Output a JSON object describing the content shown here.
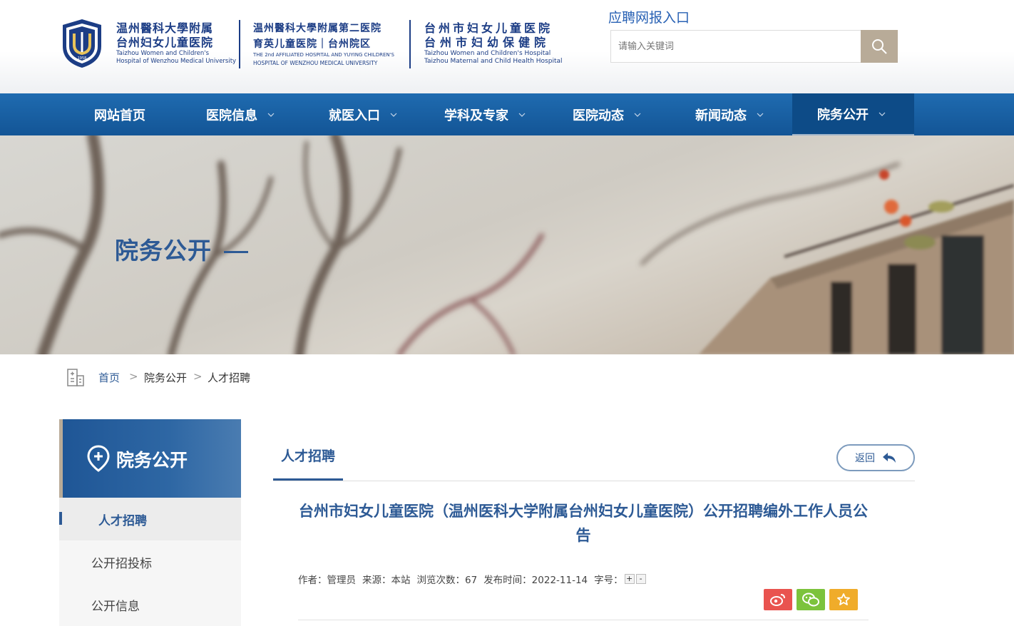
{
  "header": {
    "logo1": {
      "cn_line1": "温州醫科大學附属",
      "cn_line2": "台州妇女儿童医院",
      "en_line1": "Taizhou Women and Children's",
      "en_line2": "Hospital of Wenzhou Medical University",
      "emblem_year": "1958"
    },
    "logo2": {
      "cn_line1": "温州醫科大學附属第二医院",
      "cn_line2": "育英儿童医院｜台州院区",
      "en_line1": "THE 2nd AFFILIATED HOSPITAL AND YUYING CHILDREN'S",
      "en_line2": "HOSPITAL OF WENZHOU MEDICAL UNIVERSITY"
    },
    "logo3": {
      "cn_line1": "台州市妇女儿童医院",
      "cn_line2": "台州市妇幼保健院",
      "en_line1": "Taizhou Women and Children's Hospital",
      "en_line2": "Taizhou Maternal and Child Health Hospital"
    },
    "recruit_link": "应聘网报入口",
    "search": {
      "placeholder": "请输入关键词",
      "icon": "search-icon"
    }
  },
  "nav": {
    "items": [
      {
        "label": "网站首页",
        "dropdown": false,
        "active": false
      },
      {
        "label": "医院信息",
        "dropdown": true,
        "active": false
      },
      {
        "label": "就医入口",
        "dropdown": true,
        "active": false
      },
      {
        "label": "学科及专家",
        "dropdown": true,
        "active": false
      },
      {
        "label": "医院动态",
        "dropdown": true,
        "active": false
      },
      {
        "label": "新闻动态",
        "dropdown": true,
        "active": false
      },
      {
        "label": "院务公开",
        "dropdown": true,
        "active": true
      }
    ]
  },
  "banner": {
    "title": "院务公开"
  },
  "breadcrumb": {
    "home": "首页",
    "level1": "院务公开",
    "current": "人才招聘",
    "separator": ">"
  },
  "sidebar": {
    "title": "院务公开",
    "items": [
      {
        "label": "人才招聘",
        "active": true
      },
      {
        "label": "公开招投标",
        "active": false
      },
      {
        "label": "公开信息",
        "active": false
      }
    ]
  },
  "main": {
    "tab_title": "人才招聘",
    "back_label": "返回",
    "article_title": "台州市妇女儿童医院（温州医科大学附属台州妇女儿童医院）公开招聘编外工作人员公告",
    "meta": {
      "author": "作者：管理员",
      "source": "来源：本站",
      "views": "浏览次数：67",
      "date": "发布时间：2022-11-14",
      "font_size_label": "字号：",
      "font_plus": "+",
      "font_minus": "-"
    },
    "share": [
      {
        "icon": "weibo-icon",
        "color": "#e9534f"
      },
      {
        "icon": "wechat-icon",
        "color": "#7cc33c"
      },
      {
        "icon": "star-icon",
        "color": "#f0ac2a"
      }
    ]
  },
  "colors": {
    "nav_blue": "#135596",
    "brand_blue": "#2d5a95",
    "logo_navy": "#1c3d85",
    "search_btn": "#b8ab98"
  }
}
